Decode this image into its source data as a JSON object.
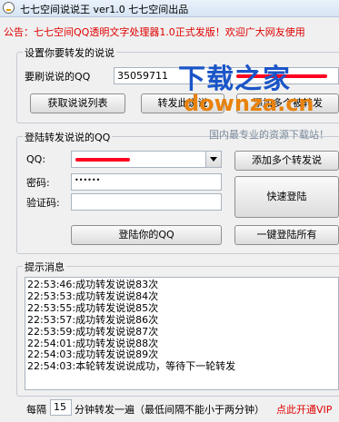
{
  "window": {
    "title": "七七空间说说王 ver1.0  七七空间出品"
  },
  "notice": "公告：七七空间QQ透明文字处理器1.0正式发版！欢迎广大网友使用",
  "forward_group": {
    "legend": "设置你要转发的说说",
    "qq_label": "要刷说说的QQ",
    "qq_value": "35059711",
    "get_list_button": "获取说说列表",
    "forward_this_button": "转发此说说",
    "add_forward_button": "添加多个被转发"
  },
  "login_group": {
    "legend": "登陆转发说说的QQ",
    "qq_label": "QQ:",
    "password_label": "密码:",
    "password_value": "••••••",
    "captcha_label": "验证码:",
    "add_multi_button": "添加多个转发说",
    "quick_login_button": "快速登陆",
    "login_button": "登陆你的QQ",
    "login_all_button": "一键登陆所有"
  },
  "log_group": {
    "legend": "提示消息",
    "lines": [
      "22:53:46:成功转发说说83次",
      "22:53:53:成功转发说说84次",
      "22:53:55:成功转发说说85次",
      "22:53:57:成功转发说说86次",
      "22:53:59:成功转发说说87次",
      "22:54:01:成功转发说说88次",
      "22:54:03:成功转发说说89次",
      "22:54:03:本轮转发说说成功，等待下一轮转发"
    ]
  },
  "footer": {
    "prefix": "每隔",
    "interval_value": "15",
    "suffix": "分钟转发一遍（最低间隔不能小于两分钟）",
    "vip_link": "点此开通VIP"
  },
  "watermark": {
    "line1": "下载之家",
    "line2": "downza.cn",
    "line3": "国内最专业的资源下载站！"
  },
  "colors": {
    "notice": "#e00000",
    "vip": "#e00000",
    "watermark_blue": "#1a55c8",
    "watermark_orange": "#e8820c"
  }
}
